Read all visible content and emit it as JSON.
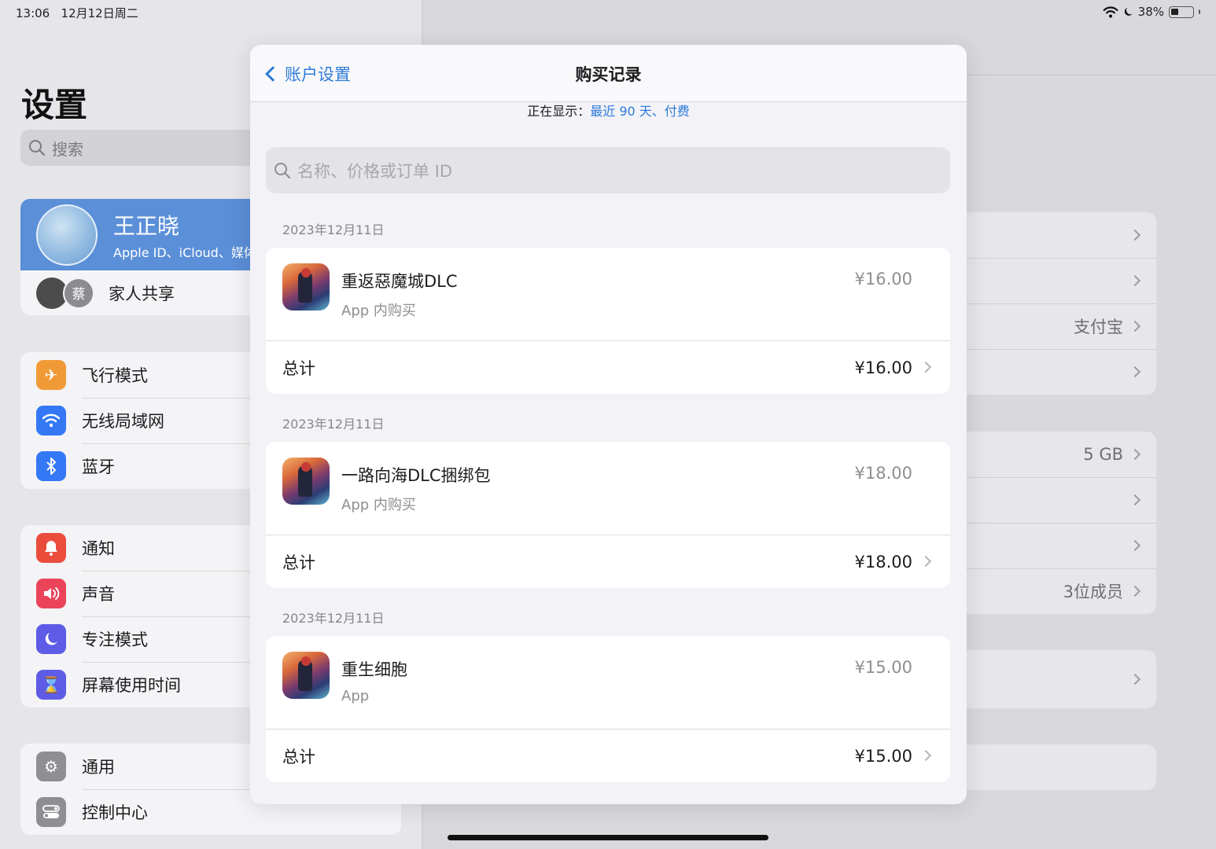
{
  "status_bar": {
    "time": "13:06",
    "date": "12月12日周二",
    "battery": "38%"
  },
  "sidebar": {
    "title": "设置",
    "search_placeholder": "搜索",
    "profile": {
      "name": "王正晓",
      "subtitle": "Apple ID、iCloud、媒体与购买项目"
    },
    "family": {
      "label": "家人共享",
      "avatar_initial": "蔡"
    },
    "group1": [
      {
        "label": "飞行模式",
        "icon": "airplane-icon",
        "color": "#f09a37"
      },
      {
        "label": "无线局域网",
        "icon": "wifi-icon",
        "color": "#3478f6"
      },
      {
        "label": "蓝牙",
        "icon": "bluetooth-icon",
        "color": "#3478f6"
      }
    ],
    "group2": [
      {
        "label": "通知",
        "icon": "bell-icon",
        "color": "#eb4d3d"
      },
      {
        "label": "声音",
        "icon": "speaker-icon",
        "color": "#eb445a"
      },
      {
        "label": "专注模式",
        "icon": "moon-icon",
        "color": "#5e5ce6"
      },
      {
        "label": "屏幕使用时间",
        "icon": "hourglass-icon",
        "color": "#5e5ce6"
      }
    ],
    "group3": [
      {
        "label": "通用",
        "icon": "gear-icon",
        "color": "#8e8e93"
      },
      {
        "label": "控制中心",
        "icon": "toggles-icon",
        "color": "#8e8e93"
      }
    ]
  },
  "right_pane": {
    "group1": [
      "",
      "",
      "支付宝",
      ""
    ],
    "group2": [
      "5 GB",
      "",
      "",
      "3位成员"
    ]
  },
  "modal": {
    "back_label": "账户设置",
    "title": "购买记录",
    "showing_prefix": "正在显示：",
    "showing_filter": "最近 90 天、付费",
    "search_placeholder": "名称、价格或订单 ID",
    "total_label": "总计",
    "purchases": [
      {
        "date": "2023年12月11日",
        "name": "重返惡魔城DLC",
        "type": "App 内购买",
        "price": "¥16.00",
        "total": "¥16.00"
      },
      {
        "date": "2023年12月11日",
        "name": "一路向海DLC捆绑包",
        "type": "App 内购买",
        "price": "¥18.00",
        "total": "¥18.00"
      },
      {
        "date": "2023年12月11日",
        "name": "重生细胞",
        "type": "App",
        "price": "¥15.00",
        "total": "¥15.00"
      }
    ]
  }
}
